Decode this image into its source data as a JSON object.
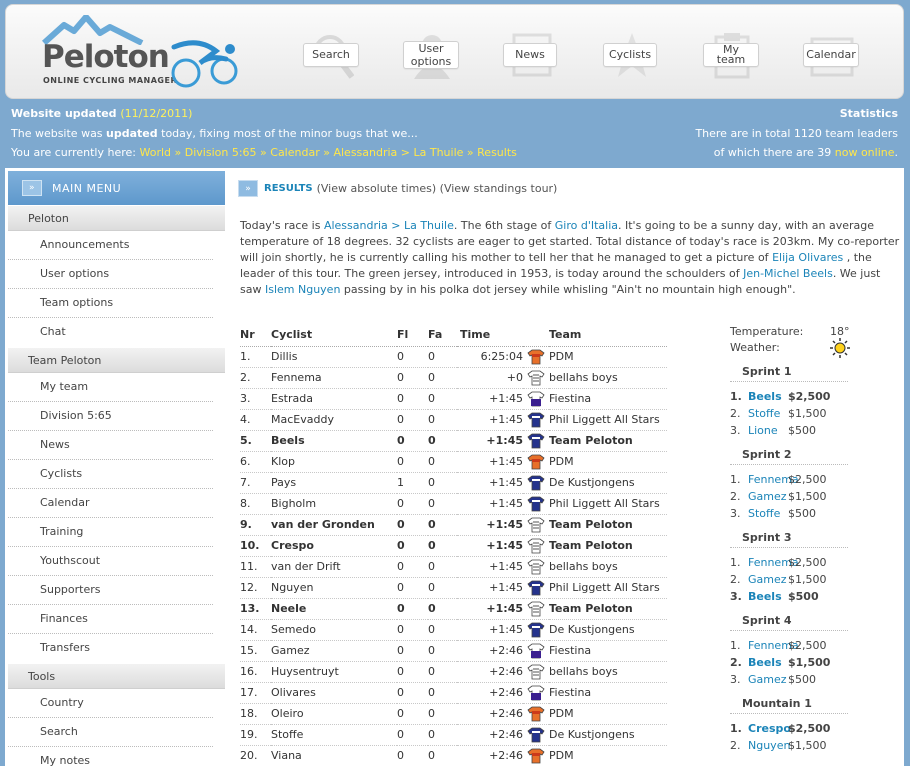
{
  "header": {
    "logo_text": "Peloton",
    "logo_subtitle": "ONLINE CYCLING MANAGER",
    "nav": [
      {
        "label": "Search",
        "icon": "magnifier-icon"
      },
      {
        "label": "User options",
        "icon": "user-icon"
      },
      {
        "label": "News",
        "icon": "newspaper-icon"
      },
      {
        "label": "Cyclists",
        "icon": "star-icon"
      },
      {
        "label": "My team",
        "icon": "clipboard-icon"
      },
      {
        "label": "Calendar",
        "icon": "calendar-icon"
      }
    ]
  },
  "info": {
    "updated_label": "Website updated",
    "updated_date": "(11/12/2011)",
    "updated_text_pre": "The website was ",
    "updated_text_bold": "updated",
    "updated_text_post": " today, fixing most of the minor bugs that we...",
    "breadcrumb_label": "You are currently here:",
    "breadcrumb": [
      "World",
      "Division 5:65",
      "Calendar",
      "Alessandria > La Thuile",
      "Results"
    ],
    "stats_title": "Statistics",
    "stats_line1": "There are in total 1120 team leaders",
    "stats_line2_pre": "of which there are 39 ",
    "stats_line2_link": "now online",
    "stats_line2_post": "."
  },
  "sidebar": {
    "title": "MAIN MENU",
    "sections": [
      {
        "label": "Peloton",
        "items": [
          "Announcements",
          "User options",
          "Team options",
          "Chat"
        ]
      },
      {
        "label": "Team Peloton",
        "items": [
          "My team",
          "Division 5:65",
          "News",
          "Cyclists",
          "Calendar",
          "Training",
          "Youthscout",
          "Supporters",
          "Finances",
          "Transfers"
        ]
      },
      {
        "label": "Tools",
        "items": [
          "Country",
          "Search",
          "My notes"
        ]
      }
    ]
  },
  "results": {
    "title": "RESULTS",
    "link1": "(View absolute times)",
    "link2": "(View standings tour)",
    "intro": {
      "p1": "Today's race is ",
      "race": "Alessandria > La Thuile",
      "p2": ". The 6th stage of ",
      "tour": "Giro d'Italia",
      "p3": ". It's going to be a sunny day, with an average temperature of 18 degrees. 32 cyclists are eager to get started. Total distance of today's race is 203km. My co-reporter will join shortly, he is currently calling his mother to tell her that he managed to get a picture of ",
      "leader": "Elija Olivares",
      "p4": " , the leader of this tour. The green jersey, introduced in 1953, is today around the schoulders of ",
      "green": "Jen-Michel Beels",
      "p5": ". We just saw ",
      "polka": "Islem Nguyen",
      "p6": " passing by in his polka dot jersey while whisling \"Ain't no mountain high enough\"."
    },
    "columns": [
      "Nr",
      "Cyclist",
      "Fl",
      "Fa",
      "Time",
      "Team"
    ],
    "rows": [
      {
        "nr": "1.",
        "cyclist": "Dillis",
        "fl": "0",
        "fa": "0",
        "time": "6:25:04",
        "team": "PDM",
        "jersey": "orange",
        "bold": false
      },
      {
        "nr": "2.",
        "cyclist": "Fennema",
        "fl": "0",
        "fa": "0",
        "time": "+0",
        "team": "bellahs boys",
        "jersey": "white",
        "bold": false
      },
      {
        "nr": "3.",
        "cyclist": "Estrada",
        "fl": "0",
        "fa": "0",
        "time": "+1:45",
        "team": "Fiestina",
        "jersey": "whitepurple",
        "bold": false
      },
      {
        "nr": "4.",
        "cyclist": "MacEvaddy",
        "fl": "0",
        "fa": "0",
        "time": "+1:45",
        "team": "Phil Liggett All Stars",
        "jersey": "blue",
        "bold": false
      },
      {
        "nr": "5.",
        "cyclist": "Beels",
        "fl": "0",
        "fa": "0",
        "time": "+1:45",
        "team": "Team Peloton",
        "jersey": "blue",
        "bold": true
      },
      {
        "nr": "6.",
        "cyclist": "Klop",
        "fl": "0",
        "fa": "0",
        "time": "+1:45",
        "team": "PDM",
        "jersey": "orange",
        "bold": false
      },
      {
        "nr": "7.",
        "cyclist": "Pays",
        "fl": "1",
        "fa": "0",
        "time": "+1:45",
        "team": "De Kustjongens",
        "jersey": "blue",
        "bold": false
      },
      {
        "nr": "8.",
        "cyclist": "Bigholm",
        "fl": "0",
        "fa": "0",
        "time": "+1:45",
        "team": "Phil Liggett All Stars",
        "jersey": "blue",
        "bold": false
      },
      {
        "nr": "9.",
        "cyclist": "van der Gronden",
        "fl": "0",
        "fa": "0",
        "time": "+1:45",
        "team": "Team Peloton",
        "jersey": "white",
        "bold": true
      },
      {
        "nr": "10.",
        "cyclist": "Crespo",
        "fl": "0",
        "fa": "0",
        "time": "+1:45",
        "team": "Team Peloton",
        "jersey": "white",
        "bold": true
      },
      {
        "nr": "11.",
        "cyclist": "van der Drift",
        "fl": "0",
        "fa": "0",
        "time": "+1:45",
        "team": "bellahs boys",
        "jersey": "white",
        "bold": false
      },
      {
        "nr": "12.",
        "cyclist": "Nguyen",
        "fl": "0",
        "fa": "0",
        "time": "+1:45",
        "team": "Phil Liggett All Stars",
        "jersey": "blue",
        "bold": false
      },
      {
        "nr": "13.",
        "cyclist": "Neele",
        "fl": "0",
        "fa": "0",
        "time": "+1:45",
        "team": "Team Peloton",
        "jersey": "white",
        "bold": true
      },
      {
        "nr": "14.",
        "cyclist": "Semedo",
        "fl": "0",
        "fa": "0",
        "time": "+1:45",
        "team": "De Kustjongens",
        "jersey": "blue",
        "bold": false
      },
      {
        "nr": "15.",
        "cyclist": "Gamez",
        "fl": "0",
        "fa": "0",
        "time": "+2:46",
        "team": "Fiestina",
        "jersey": "whitepurple",
        "bold": false
      },
      {
        "nr": "16.",
        "cyclist": "Huysentruyt",
        "fl": "0",
        "fa": "0",
        "time": "+2:46",
        "team": "bellahs boys",
        "jersey": "white",
        "bold": false
      },
      {
        "nr": "17.",
        "cyclist": "Olivares",
        "fl": "0",
        "fa": "0",
        "time": "+2:46",
        "team": "Fiestina",
        "jersey": "whitepurple",
        "bold": false
      },
      {
        "nr": "18.",
        "cyclist": "Oleiro",
        "fl": "0",
        "fa": "0",
        "time": "+2:46",
        "team": "PDM",
        "jersey": "orange",
        "bold": false
      },
      {
        "nr": "19.",
        "cyclist": "Stoffe",
        "fl": "0",
        "fa": "0",
        "time": "+2:46",
        "team": "De Kustjongens",
        "jersey": "blue",
        "bold": false
      },
      {
        "nr": "20.",
        "cyclist": "Viana",
        "fl": "0",
        "fa": "0",
        "time": "+2:46",
        "team": "PDM",
        "jersey": "orange",
        "bold": false
      }
    ]
  },
  "weather": {
    "temperature_label": "Temperature:",
    "temperature_value": "18°",
    "weather_label": "Weather:",
    "weather_icon": "sun-icon"
  },
  "sprints": [
    {
      "title": "Sprint 1",
      "rows": [
        {
          "n": "1.",
          "name": "Beels",
          "prize": "$2,500",
          "bold": true
        },
        {
          "n": "2.",
          "name": "Stoffe",
          "prize": "$1,500",
          "bold": false
        },
        {
          "n": "3.",
          "name": "Lione",
          "prize": "$500",
          "bold": false
        }
      ]
    },
    {
      "title": "Sprint 2",
      "rows": [
        {
          "n": "1.",
          "name": "Fennema",
          "prize": "$2,500",
          "bold": false
        },
        {
          "n": "2.",
          "name": "Gamez",
          "prize": "$1,500",
          "bold": false
        },
        {
          "n": "3.",
          "name": "Stoffe",
          "prize": "$500",
          "bold": false
        }
      ]
    },
    {
      "title": "Sprint 3",
      "rows": [
        {
          "n": "1.",
          "name": "Fennema",
          "prize": "$2,500",
          "bold": false
        },
        {
          "n": "2.",
          "name": "Gamez",
          "prize": "$1,500",
          "bold": false
        },
        {
          "n": "3.",
          "name": "Beels",
          "prize": "$500",
          "bold": true
        }
      ]
    },
    {
      "title": "Sprint 4",
      "rows": [
        {
          "n": "1.",
          "name": "Fennema",
          "prize": "$2,500",
          "bold": false
        },
        {
          "n": "2.",
          "name": "Beels",
          "prize": "$1,500",
          "bold": true
        },
        {
          "n": "3.",
          "name": "Gamez",
          "prize": "$500",
          "bold": false
        }
      ]
    },
    {
      "title": "Mountain 1",
      "rows": [
        {
          "n": "1.",
          "name": "Crespo",
          "prize": "$2,500",
          "bold": true
        },
        {
          "n": "2.",
          "name": "Nguyen",
          "prize": "$1,500",
          "bold": false
        }
      ]
    }
  ],
  "colors": {
    "link": "#1b84b8",
    "highlight": "#ffe74a",
    "background": "#7ea9cf"
  }
}
